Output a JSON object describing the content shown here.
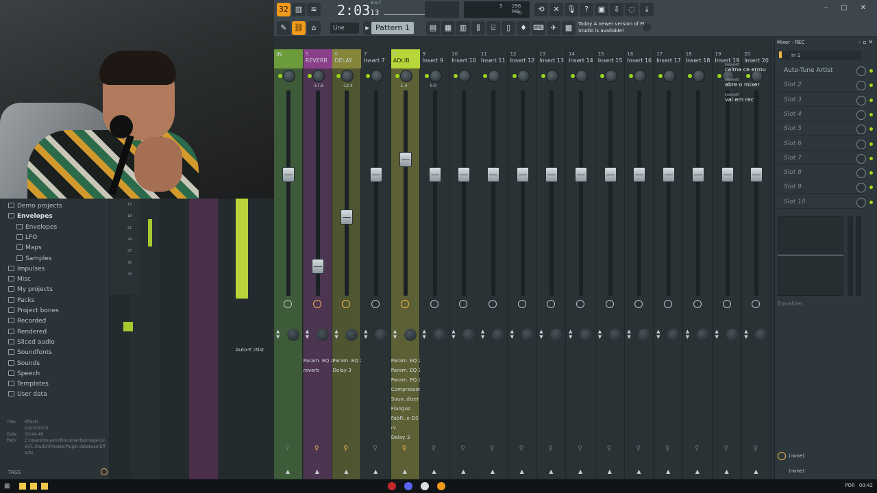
{
  "toolbar": {
    "time": "2:03",
    "time_small": "13",
    "bst": "B:S:T",
    "line_label": "Line",
    "pattern_label": "Pattern 1",
    "cpu_mem": "296 MB",
    "cpu_val1": "5",
    "cpu_val2": "0",
    "news_prefix": "Today",
    "news_text": "A newer version of FL Studio is available!",
    "window_controls": "– □ ✕"
  },
  "mixer": {
    "strips": [
      {
        "num": "",
        "name": "IN",
        "color": "green",
        "level": "",
        "fader": 0.6,
        "fx": [],
        "send_on": false
      },
      {
        "num": "5",
        "name": "REVERB",
        "color": "purple",
        "level": "-17.6",
        "fader": 0.12,
        "fx": [
          "Param. EQ 2",
          "reverb"
        ],
        "send_on": true
      },
      {
        "num": "6",
        "name": "DELAY",
        "color": "olive",
        "level": "-12.4",
        "fader": 0.38,
        "fx": [
          "Param. EQ 2",
          "Delay 3"
        ],
        "send_on": true
      },
      {
        "num": "7",
        "name": "Insert 7",
        "color": "",
        "level": "",
        "fader": 0.6,
        "fx": [],
        "send_on": false
      },
      {
        "num": "8",
        "name": "ADLIB",
        "color": "yellow",
        "level": "1.4",
        "fader": 0.68,
        "fx": [
          "Param. EQ 2",
          "Param. EQ 2",
          "Param. EQ 2",
          "Compressor",
          "Soun..dizer",
          "Flangus",
          "FabFi..o-DS",
          "rv",
          "Delay 3"
        ],
        "send_on": true
      },
      {
        "num": "9",
        "name": "Insert 9",
        "color": "",
        "level": "0.0",
        "fader": 0.6,
        "fx": [],
        "send_on": false
      },
      {
        "num": "10",
        "name": "Insert 10",
        "color": "",
        "level": "",
        "fader": 0.6,
        "fx": [],
        "send_on": false
      },
      {
        "num": "11",
        "name": "Insert 11",
        "color": "",
        "level": "",
        "fader": 0.6,
        "fx": [],
        "send_on": false
      },
      {
        "num": "12",
        "name": "Insert 12",
        "color": "",
        "level": "",
        "fader": 0.6,
        "fx": [],
        "send_on": false
      },
      {
        "num": "13",
        "name": "Insert 13",
        "color": "",
        "level": "",
        "fader": 0.6,
        "fx": [],
        "send_on": false
      },
      {
        "num": "14",
        "name": "Insert 14",
        "color": "",
        "level": "",
        "fader": 0.6,
        "fx": [],
        "send_on": false
      },
      {
        "num": "15",
        "name": "Insert 15",
        "color": "",
        "level": "",
        "fader": 0.6,
        "fx": [],
        "send_on": false
      },
      {
        "num": "16",
        "name": "Insert 16",
        "color": "",
        "level": "",
        "fader": 0.6,
        "fx": [],
        "send_on": false
      },
      {
        "num": "17",
        "name": "Insert 17",
        "color": "",
        "level": "",
        "fader": 0.6,
        "fx": [],
        "send_on": false
      },
      {
        "num": "18",
        "name": "Insert 18",
        "color": "",
        "level": "",
        "fader": 0.6,
        "fx": [],
        "send_on": false
      },
      {
        "num": "19",
        "name": "Insert 19",
        "color": "",
        "level": "",
        "fader": 0.6,
        "fx": [],
        "send_on": false
      },
      {
        "num": "20",
        "name": "Insert 20",
        "color": "",
        "level": "",
        "fader": 0.6,
        "fx": [],
        "send_on": false
      }
    ],
    "left_strips": [
      {
        "name": "Param. EQ 2",
        "fx": [
          "Param. EQ 2",
          "Param. EQ 2",
          "Param. EQ 2",
          "Compressor",
          "Soun..dizer",
          "Flangus",
          "FabFi..o-DS"
        ]
      },
      {
        "name": "Auto-T..rtist",
        "fx": [
          "Auto-T..rtist"
        ]
      }
    ]
  },
  "chat": [
    {
      "user": "EMOIHART",
      "text": "calma ce errou"
    },
    {
      "user": "EMOIHART",
      "text": "abre o mixer"
    },
    {
      "user": "EMOIHART",
      "text": "vai em rec"
    }
  ],
  "rpanel": {
    "title": "Mixer - REC",
    "input": "In 1",
    "slots": [
      "Auto-Tune Artist",
      "Slot 2",
      "Slot 3",
      "Slot 4",
      "Slot 5",
      "Slot 6",
      "Slot 7",
      "Slot 8",
      "Slot 9",
      "Slot 10"
    ],
    "eq_label": "Equalizer",
    "out1": "(none)",
    "out2": "(none)"
  },
  "browser": {
    "items": [
      {
        "label": "Demo projects",
        "sub": false,
        "bold": false
      },
      {
        "label": "Envelopes",
        "sub": false,
        "bold": true
      },
      {
        "label": "Envelopes",
        "sub": true,
        "bold": false
      },
      {
        "label": "LFO",
        "sub": true,
        "bold": false
      },
      {
        "label": "Maps",
        "sub": true,
        "bold": false
      },
      {
        "label": "Samples",
        "sub": true,
        "bold": false
      },
      {
        "label": "Impulses",
        "sub": false,
        "bold": false
      },
      {
        "label": "Misc",
        "sub": false,
        "bold": false
      },
      {
        "label": "My projects",
        "sub": false,
        "bold": false
      },
      {
        "label": "Packs",
        "sub": false,
        "bold": false
      },
      {
        "label": "Project bones",
        "sub": false,
        "bold": false
      },
      {
        "label": "Recorded",
        "sub": false,
        "bold": false
      },
      {
        "label": "Rendered",
        "sub": false,
        "bold": false
      },
      {
        "label": "Sliced audio",
        "sub": false,
        "bold": false
      },
      {
        "label": "Soundfonts",
        "sub": false,
        "bold": false
      },
      {
        "label": "Sounds",
        "sub": false,
        "bold": false
      },
      {
        "label": "Speech",
        "sub": false,
        "bold": false
      },
      {
        "label": "Templates",
        "sub": false,
        "bold": false
      },
      {
        "label": "User data",
        "sub": false,
        "bold": false
      }
    ],
    "meta_title_k": "Title",
    "meta_title_v": "Effects",
    "meta_date_k": "Date",
    "meta_date_v": "12/02/2025 10:44:48",
    "meta_path_k": "Path",
    "meta_path_v": "C:\\Users\\Usuario\\Documents\\Image-Line\\FL Studio\\Presets\\Plugin database\\Effects",
    "tags": "TAGS"
  },
  "ruler": [
    "15",
    "18",
    "21",
    "24",
    "27",
    "30",
    "33"
  ],
  "taskbar": {
    "lang": "POR",
    "clock": "00:42"
  }
}
